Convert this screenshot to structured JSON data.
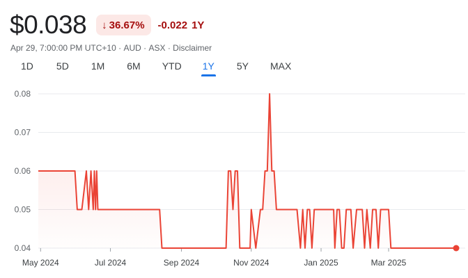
{
  "quote": {
    "price": "$0.038",
    "change_percent": "36.67%",
    "change_direction_icon": "arrow-down-icon",
    "change_absolute": "-0.022",
    "change_period": "1Y",
    "negative_color": "#a50e0e",
    "negative_bg": "#fce8e6"
  },
  "meta": {
    "timestamp": "Apr 29, 7:00:00 PM UTC+10",
    "currency": "AUD",
    "exchange": "ASX",
    "disclaimer": "Disclaimer"
  },
  "tabs": [
    {
      "label": "1D",
      "active": false
    },
    {
      "label": "5D",
      "active": false
    },
    {
      "label": "1M",
      "active": false
    },
    {
      "label": "6M",
      "active": false
    },
    {
      "label": "YTD",
      "active": false
    },
    {
      "label": "1Y",
      "active": true
    },
    {
      "label": "5Y",
      "active": false
    },
    {
      "label": "MAX",
      "active": false
    }
  ],
  "chart_data": {
    "type": "line",
    "title": "",
    "xlabel": "",
    "ylabel": "",
    "ylim": [
      0.04,
      0.08
    ],
    "y_ticks": [
      "0.08",
      "0.07",
      "0.06",
      "0.05",
      "0.04"
    ],
    "x_ticks": [
      {
        "label": "May 2024",
        "date": "2024-05-01"
      },
      {
        "label": "Jul 2024",
        "date": "2024-07-01"
      },
      {
        "label": "Sep 2024",
        "date": "2024-09-01"
      },
      {
        "label": "Nov 2024",
        "date": "2024-11-01"
      },
      {
        "label": "Jan 2025",
        "date": "2025-01-01"
      },
      {
        "label": "Mar 2025",
        "date": "2025-03-01"
      }
    ],
    "grid": "horizontal",
    "line_color": "#ea4335",
    "series": [
      {
        "x": [
          "2024-04-29",
          "2024-05-01",
          "2024-05-15",
          "2024-05-31",
          "2024-06-02",
          "2024-06-04",
          "2024-06-06",
          "2024-06-10",
          "2024-06-12",
          "2024-06-14",
          "2024-06-16",
          "2024-06-17",
          "2024-06-18",
          "2024-06-19",
          "2024-06-20",
          "2024-06-22",
          "2024-06-24",
          "2024-06-30",
          "2024-07-15",
          "2024-08-01",
          "2024-08-13",
          "2024-08-15",
          "2024-09-01",
          "2024-10-01",
          "2024-10-10",
          "2024-10-12",
          "2024-10-14",
          "2024-10-16",
          "2024-10-18",
          "2024-10-20",
          "2024-10-22",
          "2024-10-24",
          "2024-10-31",
          "2024-11-01",
          "2024-11-05",
          "2024-11-09",
          "2024-11-11",
          "2024-11-13",
          "2024-11-15",
          "2024-11-17",
          "2024-11-19",
          "2024-11-21",
          "2024-11-23",
          "2024-11-25",
          "2024-12-01",
          "2024-12-08",
          "2024-12-11",
          "2024-12-14",
          "2024-12-16",
          "2024-12-18",
          "2024-12-20",
          "2024-12-22",
          "2024-12-24",
          "2024-12-26",
          "2024-12-28",
          "2024-12-30",
          "2025-01-05",
          "2025-01-12",
          "2025-01-13",
          "2025-01-15",
          "2025-01-17",
          "2025-01-19",
          "2025-01-21",
          "2025-01-23",
          "2025-01-25",
          "2025-01-27",
          "2025-01-29",
          "2025-02-01",
          "2025-02-06",
          "2025-02-08",
          "2025-02-10",
          "2025-02-13",
          "2025-02-15",
          "2025-02-18",
          "2025-02-20",
          "2025-02-22",
          "2025-02-25",
          "2025-03-01",
          "2025-03-03",
          "2025-03-15",
          "2025-04-01",
          "2025-04-15",
          "2025-04-29"
        ],
        "values": [
          0.06,
          0.06,
          0.06,
          0.06,
          0.05,
          0.05,
          0.05,
          0.06,
          0.05,
          0.06,
          0.05,
          0.06,
          0.05,
          0.06,
          0.05,
          0.05,
          0.05,
          0.05,
          0.05,
          0.05,
          0.05,
          0.04,
          0.04,
          0.04,
          0.04,
          0.06,
          0.06,
          0.05,
          0.06,
          0.06,
          0.04,
          0.04,
          0.04,
          0.05,
          0.04,
          0.05,
          0.05,
          0.06,
          0.06,
          0.08,
          0.06,
          0.06,
          0.05,
          0.05,
          0.05,
          0.05,
          0.05,
          0.04,
          0.05,
          0.04,
          0.05,
          0.05,
          0.04,
          0.05,
          0.05,
          0.05,
          0.05,
          0.05,
          0.04,
          0.05,
          0.05,
          0.04,
          0.04,
          0.05,
          0.05,
          0.05,
          0.04,
          0.05,
          0.05,
          0.04,
          0.05,
          0.04,
          0.05,
          0.05,
          0.04,
          0.05,
          0.05,
          0.05,
          0.04,
          0.04,
          0.04,
          0.04,
          0.04
        ]
      }
    ]
  }
}
